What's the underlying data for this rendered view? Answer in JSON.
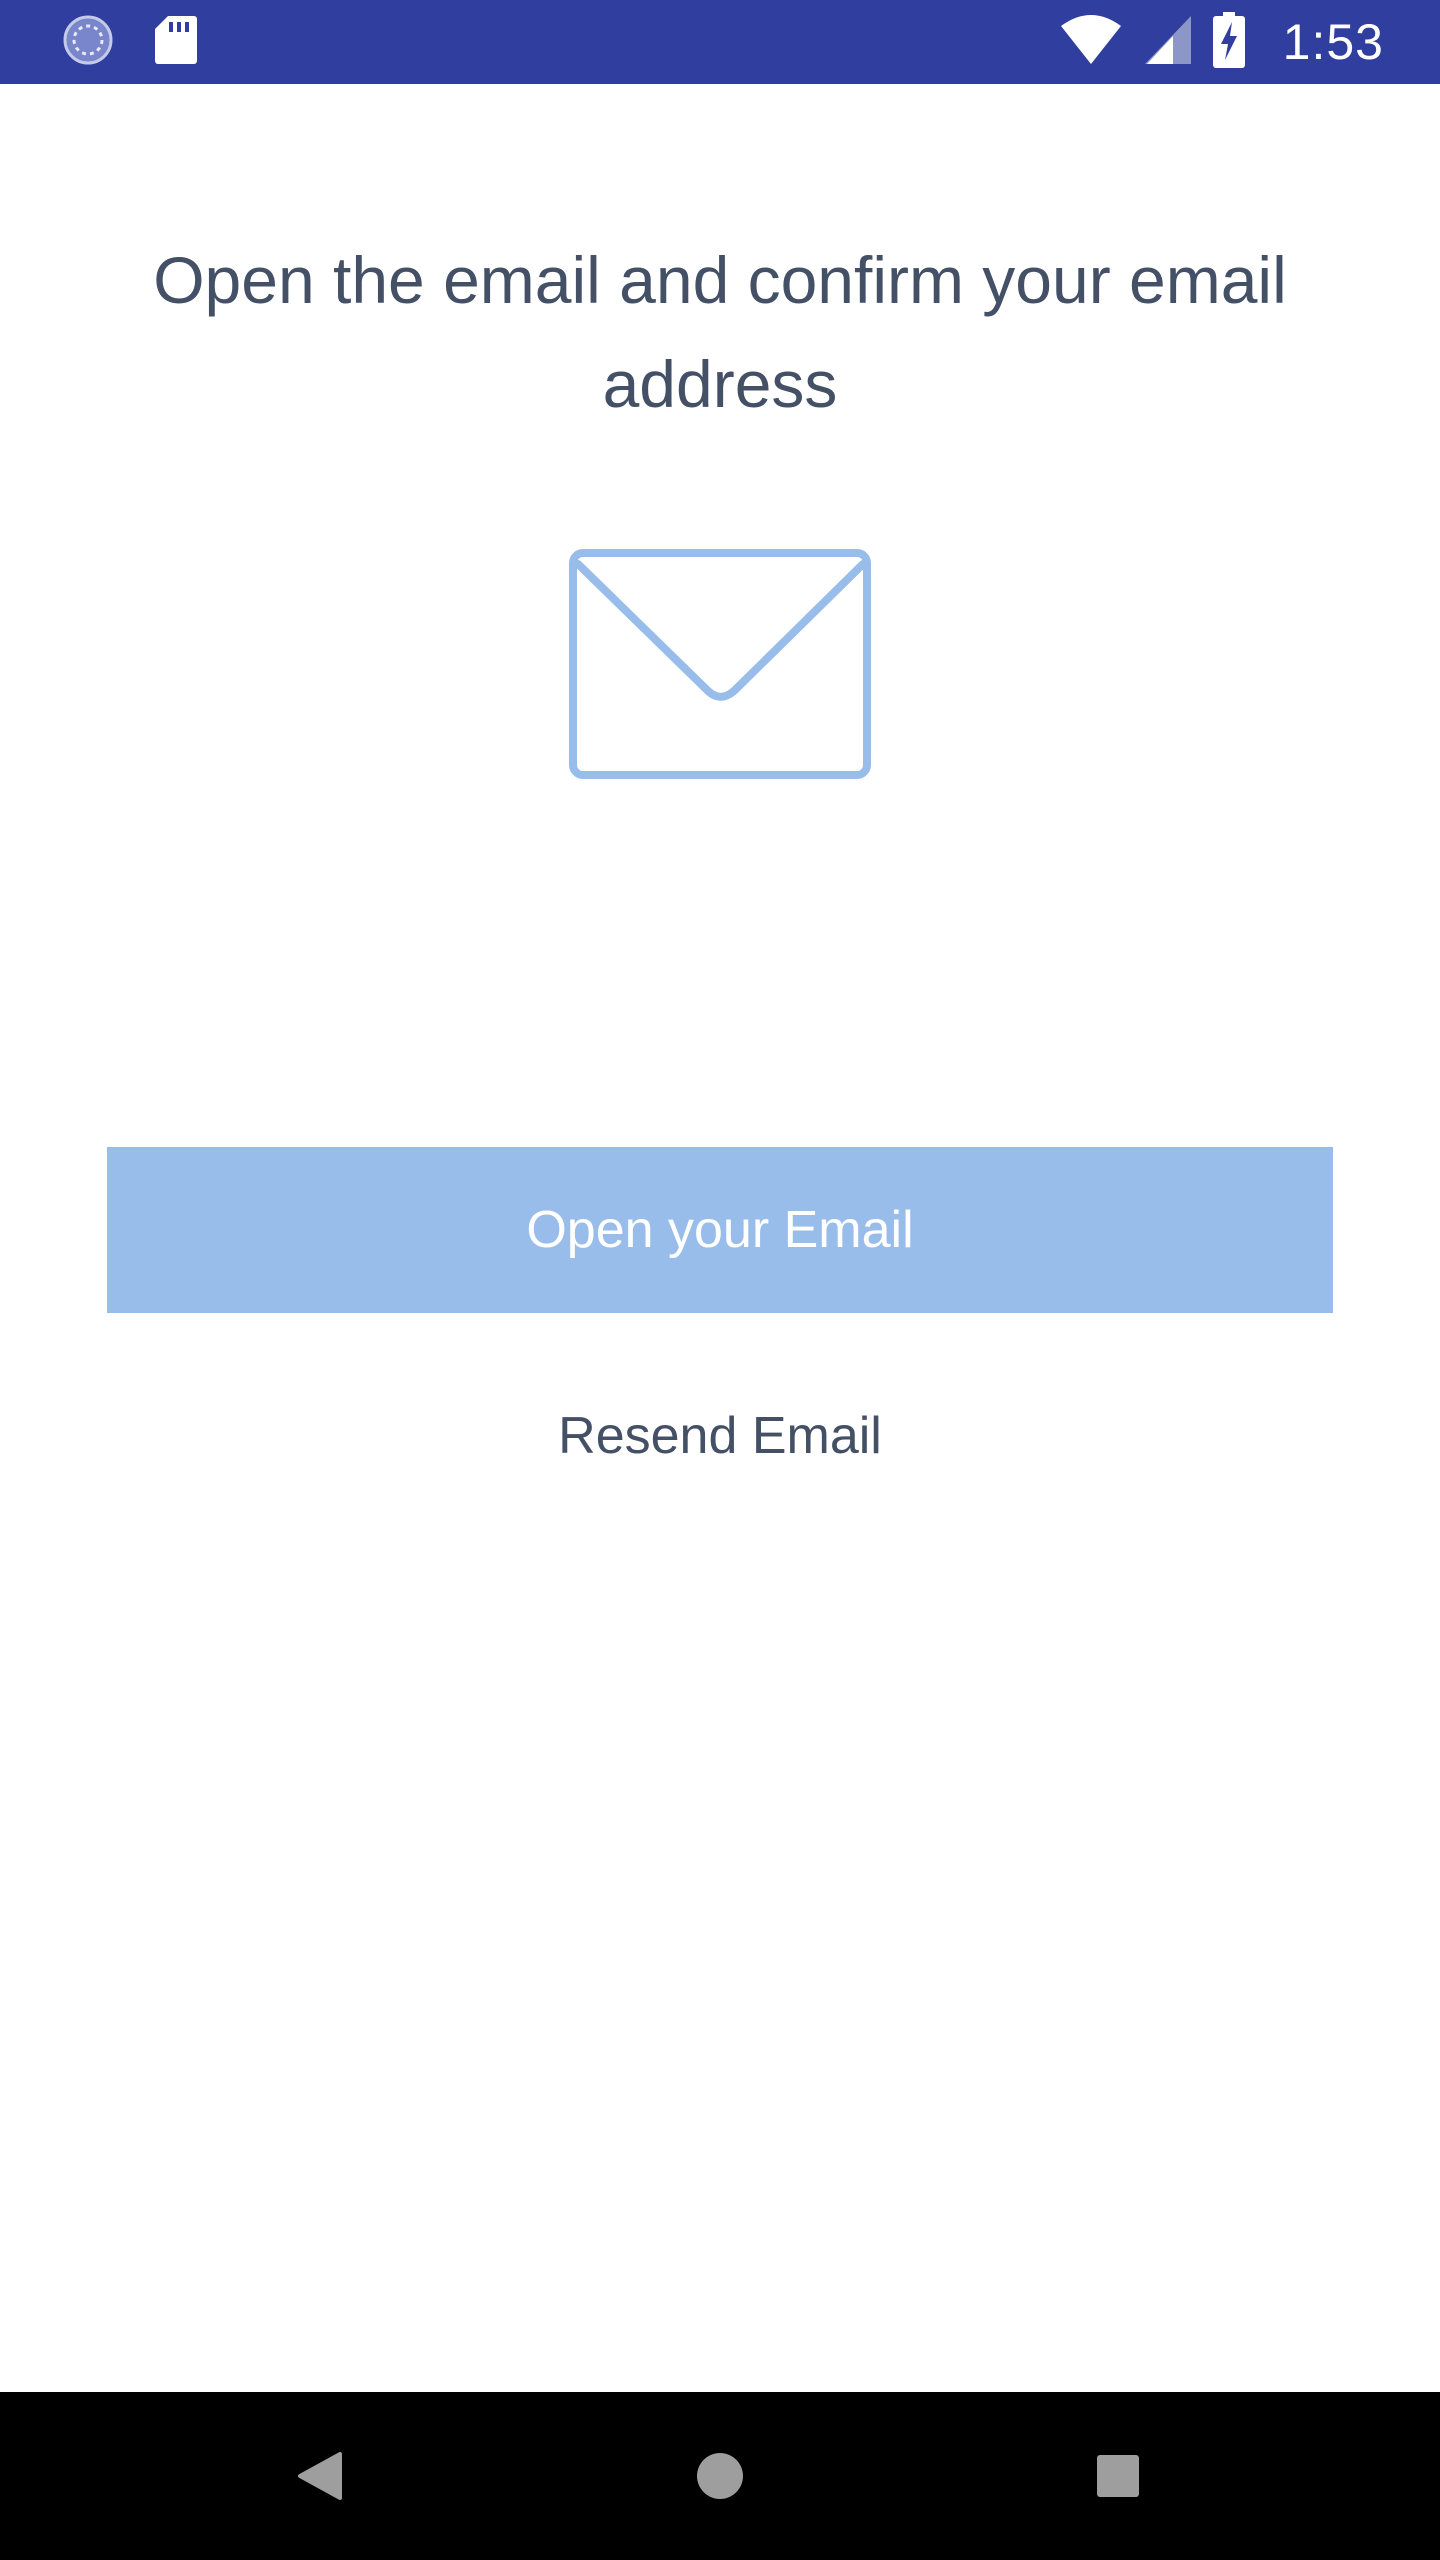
{
  "status_bar": {
    "time": "1:53",
    "left_icons": [
      "sync-icon",
      "sd-card-icon"
    ],
    "right_icons": [
      "wifi-icon",
      "cell-signal-icon",
      "battery-charging-icon"
    ],
    "background_color": "#303f9f"
  },
  "main": {
    "heading": "Open the email and confirm your email address",
    "illustration_icon": "envelope-icon",
    "open_email_button_label": "Open your Email",
    "resend_email_label": "Resend Email"
  },
  "colors": {
    "accent": "#99bdea",
    "text": "#435066"
  },
  "nav_bar": {
    "buttons": [
      "back-icon",
      "home-icon",
      "recents-icon"
    ]
  }
}
